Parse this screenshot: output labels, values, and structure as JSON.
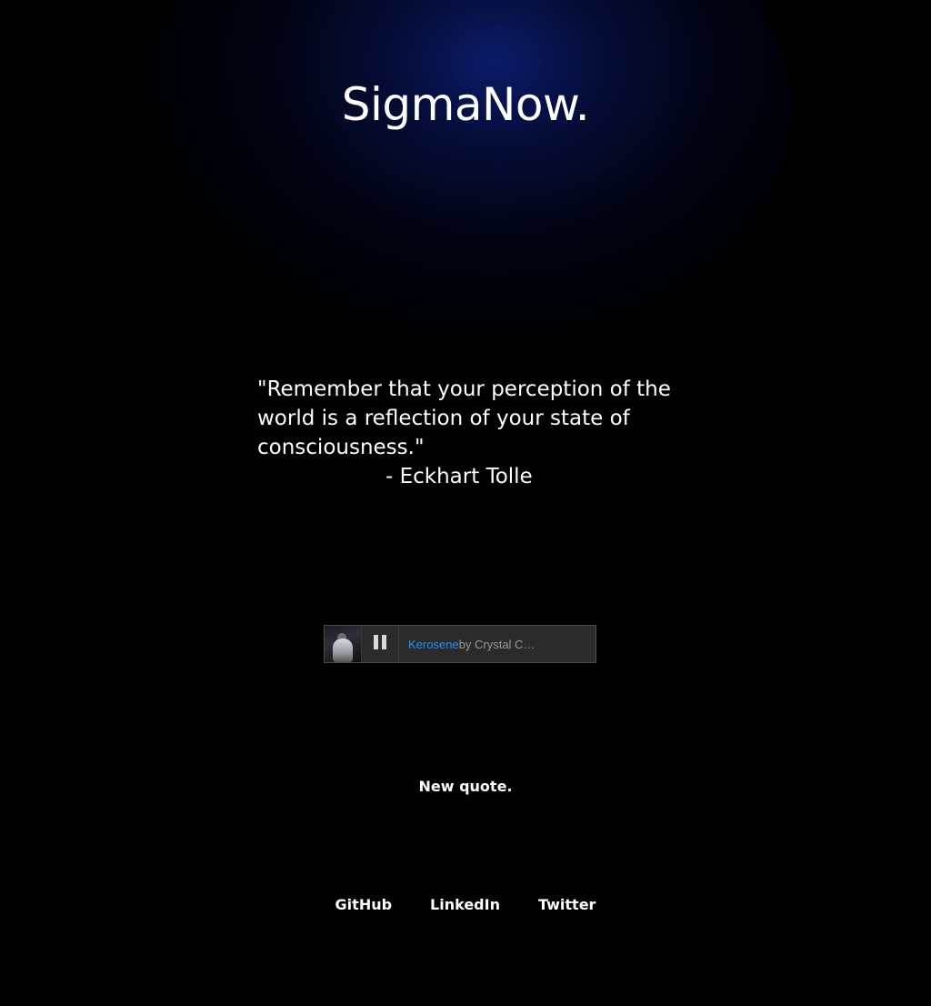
{
  "header": {
    "title": "SigmaNow."
  },
  "quote": {
    "text": "\"Remember that your perception of the world is a reflection of your state of consciousness.\"",
    "author": "- Eckhart Tolle"
  },
  "player": {
    "album_art_icon": "album-cover",
    "state_icon": "pause-icon",
    "track_title": "Kerosene",
    "by_text": " by Crystal C…",
    "track_color": "#1e90ff"
  },
  "actions": {
    "new_quote_label": "New quote."
  },
  "footer": {
    "links": [
      {
        "label": "GitHub"
      },
      {
        "label": "LinkedIn"
      },
      {
        "label": "Twitter"
      }
    ]
  },
  "colors": {
    "background": "#000000",
    "glow": "#0c1c6e",
    "text": "#ffffff"
  }
}
